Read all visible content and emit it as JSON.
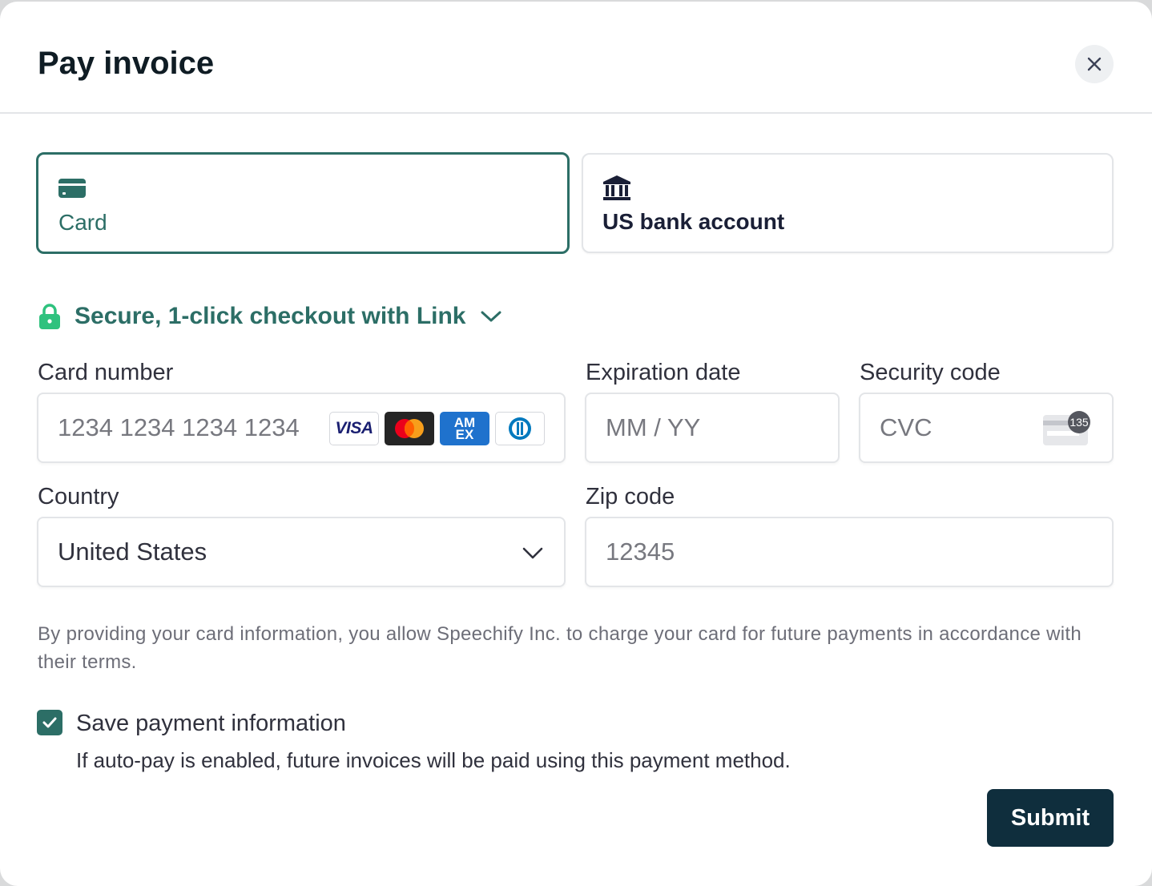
{
  "dialog": {
    "title": "Pay invoice",
    "close_icon": "close-icon"
  },
  "payment_methods": [
    {
      "label": "Card",
      "icon": "credit-card-icon",
      "selected": true
    },
    {
      "label": "US bank account",
      "icon": "bank-icon",
      "selected": false
    }
  ],
  "link": {
    "text": "Secure, 1-click checkout with Link",
    "icon": "lock-icon",
    "chevron": "chevron-down-icon"
  },
  "form": {
    "card_number": {
      "label": "Card number",
      "placeholder": "1234 1234 1234 1234",
      "value": "",
      "brands": [
        "VISA",
        "Mastercard",
        "AM EX",
        "Diners"
      ]
    },
    "expiration": {
      "label": "Expiration date",
      "placeholder": "MM / YY",
      "value": ""
    },
    "security_code": {
      "label": "Security code",
      "placeholder": "CVC",
      "value": "",
      "icon_text": "135"
    },
    "country": {
      "label": "Country",
      "value": "United States"
    },
    "zip": {
      "label": "Zip code",
      "placeholder": "12345",
      "value": ""
    }
  },
  "disclaimer": "By providing your card information, you allow Speechify Inc. to charge your card for future payments in accordance with their terms.",
  "save_payment": {
    "checked": true,
    "label": "Save payment information",
    "help": "If auto-pay is enabled, future invoices will be paid using this payment method."
  },
  "submit_label": "Submit",
  "colors": {
    "accent": "#2c6e66",
    "link_lock": "#2ec27e",
    "submit_bg": "#0f2e3d",
    "text": "#30313d",
    "muted": "#6d6e78"
  }
}
